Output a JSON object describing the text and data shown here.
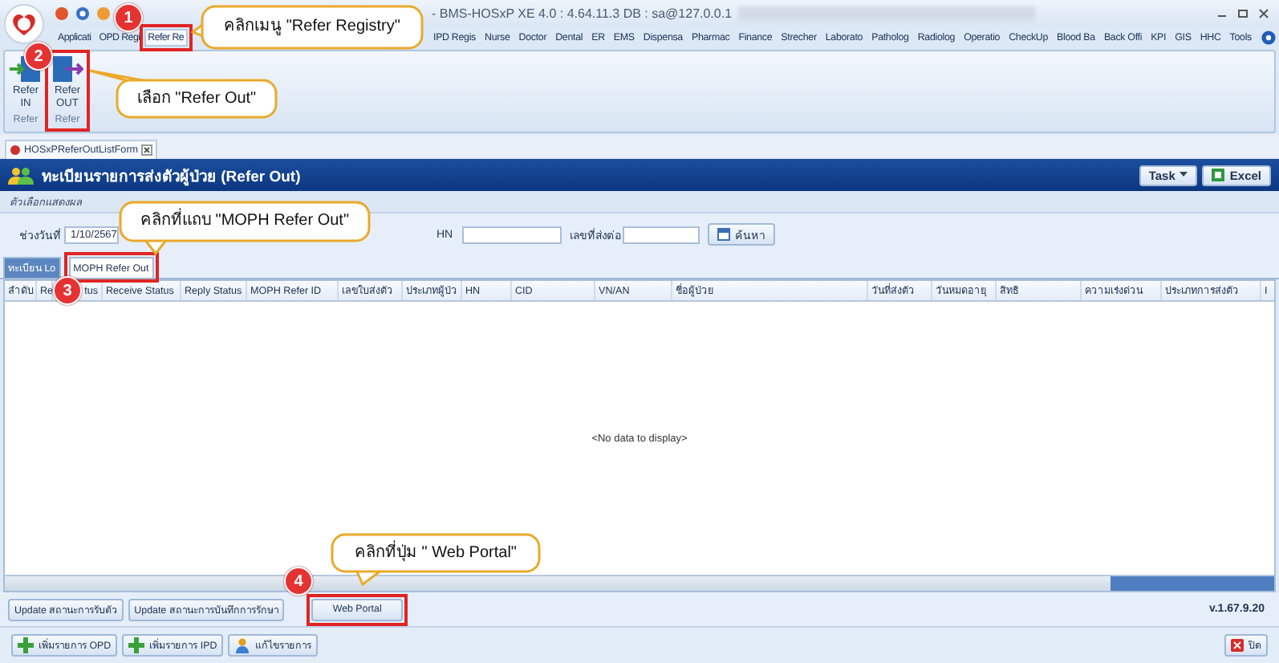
{
  "window": {
    "title": "- BMS-HOSxP XE 4.0 : 4.64.11.3 DB : sa@127.0.0.1"
  },
  "menu_tabs": [
    {
      "label": "Applicati",
      "selected": false
    },
    {
      "label": "OPD Regi",
      "selected": false
    },
    {
      "label": "Refer Re",
      "selected": true
    },
    {
      "label": "IPD Regis",
      "selected": false
    },
    {
      "label": "Nurse",
      "selected": false
    },
    {
      "label": "Doctor",
      "selected": false
    },
    {
      "label": "Dental",
      "selected": false
    },
    {
      "label": "ER",
      "selected": false
    },
    {
      "label": "EMS",
      "selected": false
    },
    {
      "label": "Dispensa",
      "selected": false
    },
    {
      "label": "Pharmac",
      "selected": false
    },
    {
      "label": "Finance",
      "selected": false
    },
    {
      "label": "Strecher",
      "selected": false
    },
    {
      "label": "Laborato",
      "selected": false
    },
    {
      "label": "Patholog",
      "selected": false
    },
    {
      "label": "Radiolog",
      "selected": false
    },
    {
      "label": "Operatio",
      "selected": false
    },
    {
      "label": "CheckUp",
      "selected": false
    },
    {
      "label": "Blood Ba",
      "selected": false
    },
    {
      "label": "Back Offi",
      "selected": false
    },
    {
      "label": "KPI",
      "selected": false
    },
    {
      "label": "GIS",
      "selected": false
    },
    {
      "label": "HHC",
      "selected": false
    },
    {
      "label": "Tools",
      "selected": false
    }
  ],
  "ribbon": {
    "buttons": [
      {
        "label": "Refer IN",
        "group": "Refer",
        "kind": "in"
      },
      {
        "label": "Refer OUT",
        "group": "Refer",
        "kind": "out"
      }
    ]
  },
  "document_tabs": [
    {
      "label": "HOSxPReferOutListForm"
    }
  ],
  "form": {
    "title": "ทะเบียนรายการส่งตัวผู้ป่วย (Refer Out)",
    "header_buttons": [
      {
        "label": "Task",
        "kind": "dropdown"
      },
      {
        "label": "Excel",
        "kind": "excel"
      }
    ],
    "options_label": "ตัวเลือกแสดงผล",
    "filters": {
      "date_label": "ช่วงวันที่",
      "date_value": "1/10/2567",
      "hn_label": "HN",
      "refer_no_label": "เลขที่ส่งต่อ",
      "search_button": "ค้นหา"
    },
    "tabs": [
      {
        "label": "ทะเบียน Lo",
        "selected": false
      },
      {
        "label": "MOPH Refer Out",
        "selected": true
      }
    ],
    "table": {
      "columns": [
        "ลำดับ",
        "Re",
        "tus",
        "Receive Status",
        "Reply Status",
        "MOPH Refer ID",
        "เลขใบส่งตัว",
        "ประเภทผู้ป่ว",
        "HN",
        "CID",
        "VN/AN",
        "ชื่อผู้ป่วย",
        "วันที่ส่งตัว",
        "วันหมดอายุ",
        "สิทธิ",
        "ความเร่งด่วน",
        "ประเภทการส่งตัว",
        "I"
      ],
      "empty_text": "<No data to display>"
    },
    "action_buttons": [
      "Update สถานะการรับตัว",
      "Update สถานะการบันทึกการรักษา",
      "Web Portal"
    ],
    "version": "v.1.67.9.20",
    "footer_buttons": [
      {
        "label": "เพิ่มรายการ OPD",
        "kind": "add"
      },
      {
        "label": "เพิ่มรายการ IPD",
        "kind": "add"
      },
      {
        "label": "แก้ไขรายการ",
        "kind": "edit"
      }
    ],
    "close_button": "ปิด"
  },
  "annotations": [
    {
      "step": "1",
      "text": "คลิกเมนู \"Refer Registry\""
    },
    {
      "step": "2",
      "text": "เลือก \"Refer Out\""
    },
    {
      "step": "3",
      "text": "คลิกที่แถบ \"MOPH Refer Out\""
    },
    {
      "step": "4",
      "text": "คลิกที่ปุ่ม \" Web Portal\""
    }
  ]
}
